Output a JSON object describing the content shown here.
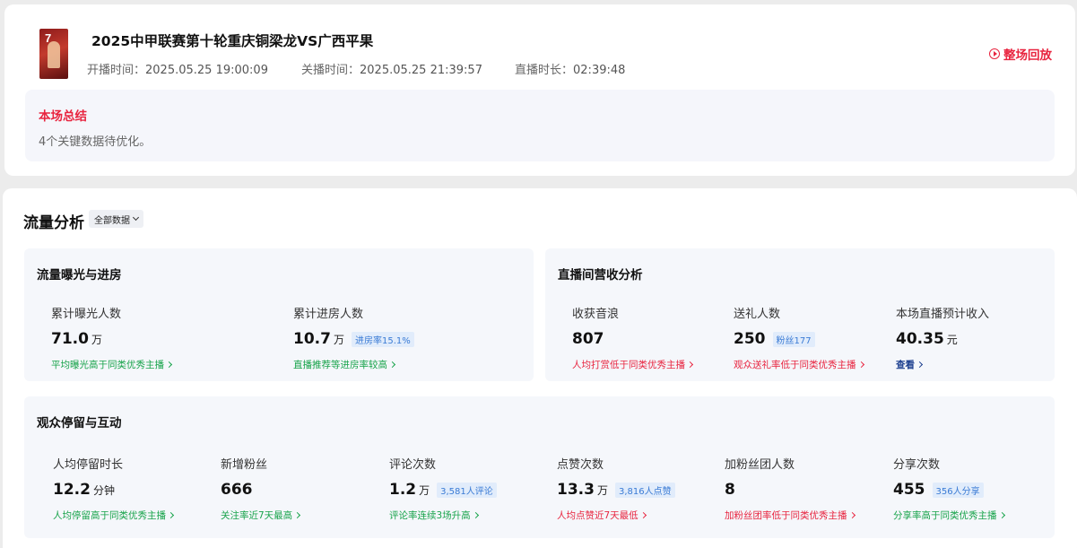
{
  "live": {
    "title": "2025中甲联赛第十轮重庆铜梁龙VS广西平果",
    "start_label": "开播时间：",
    "start_time": "2025.05.25 19:00:09",
    "end_label": "关播时间：",
    "end_time": "2025.05.25 21:39:57",
    "duration_label": "直播时长：",
    "duration": "02:39:48",
    "replay_label": "整场回放"
  },
  "summary": {
    "heading": "本场总结",
    "text": "4个关键数据待优化。"
  },
  "traffic": {
    "title": "流量分析",
    "filter_label": "全部数据"
  },
  "panels": {
    "exposure": {
      "title": "流量曝光与进房",
      "metrics": [
        {
          "label": "累计曝光人数",
          "value": "71.0",
          "unit": "万",
          "note": "平均曝光高于同类优秀主播"
        },
        {
          "label": "累计进房人数",
          "value": "10.7",
          "unit": "万",
          "badge": "进房率15.1%",
          "note": "直播推荐等进房率较高"
        }
      ]
    },
    "revenue": {
      "title": "直播间营收分析",
      "metrics": [
        {
          "label": "收获音浪",
          "value": "807",
          "note": "人均打赏低于同类优秀主播"
        },
        {
          "label": "送礼人数",
          "value": "250",
          "badge": "粉丝177",
          "note": "观众送礼率低于同类优秀主播"
        },
        {
          "label": "本场直播预计收入",
          "value": "40.35",
          "unit": "元",
          "note": "查看"
        }
      ]
    },
    "retention": {
      "title": "观众停留与互动",
      "metrics": [
        {
          "label": "人均停留时长",
          "value": "12.2",
          "unit": "分钟",
          "note": "人均停留高于同类优秀主播"
        },
        {
          "label": "新增粉丝",
          "value": "666",
          "note": "关注率近7天最高"
        },
        {
          "label": "评论次数",
          "value": "1.2",
          "unit": "万",
          "badge": "3,581人评论",
          "note": "评论率连续3场升高"
        },
        {
          "label": "点赞次数",
          "value": "13.3",
          "unit": "万",
          "badge": "3,816人点赞",
          "note": "人均点赞近7天最低"
        },
        {
          "label": "加粉丝团人数",
          "value": "8",
          "note": "加粉丝团率低于同类优秀主播"
        },
        {
          "label": "分享次数",
          "value": "455",
          "badge": "356人分享",
          "note": "分享率高于同类优秀主播"
        }
      ]
    }
  },
  "colors": {
    "accent_red": "#e8243f",
    "positive_green": "#17a34a",
    "link_blue": "#1c3f8f",
    "badge_blue": "#3a7bd5"
  }
}
